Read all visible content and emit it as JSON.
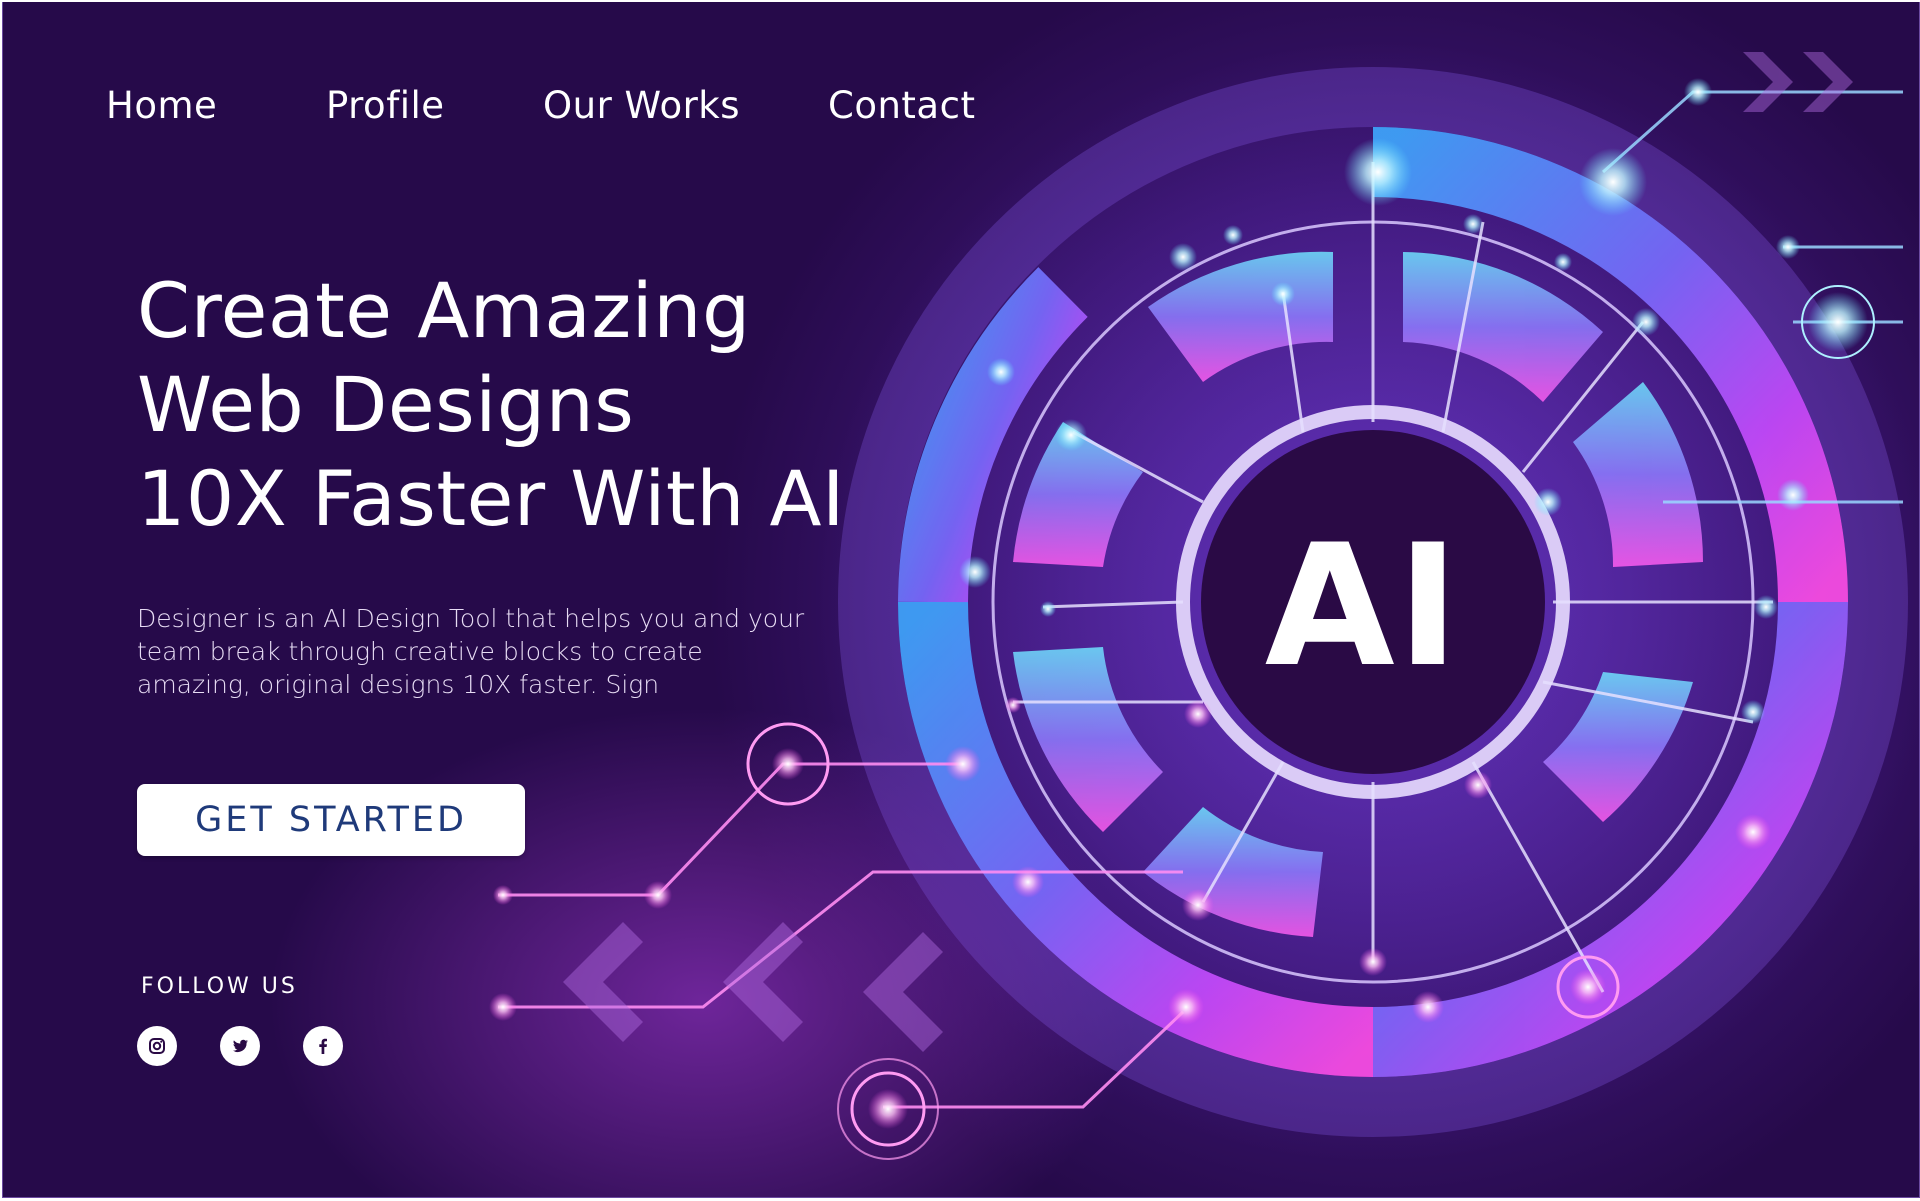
{
  "nav": {
    "items": [
      {
        "label": "Home"
      },
      {
        "label": "Profile"
      },
      {
        "label": "Our Works"
      },
      {
        "label": "Contact"
      }
    ]
  },
  "hero": {
    "title_lines": [
      "Create Amazing",
      "Web Designs",
      "10X Faster With AI"
    ],
    "description": "Designer is an AI Design Tool that helps you and your team break through creative blocks to create amazing, original designs 10X faster. Sign",
    "cta_label": "GET STARTED"
  },
  "follow": {
    "label": "FOLLOW US",
    "icons": [
      "instagram-icon",
      "twitter-icon",
      "facebook-icon"
    ]
  },
  "graphic": {
    "center_label": "AI"
  },
  "colors": {
    "background": "#260a4a",
    "accent_cyan": "#5fe8ff",
    "accent_magenta": "#ff4fe8",
    "cta_text": "#1f3a7a"
  }
}
